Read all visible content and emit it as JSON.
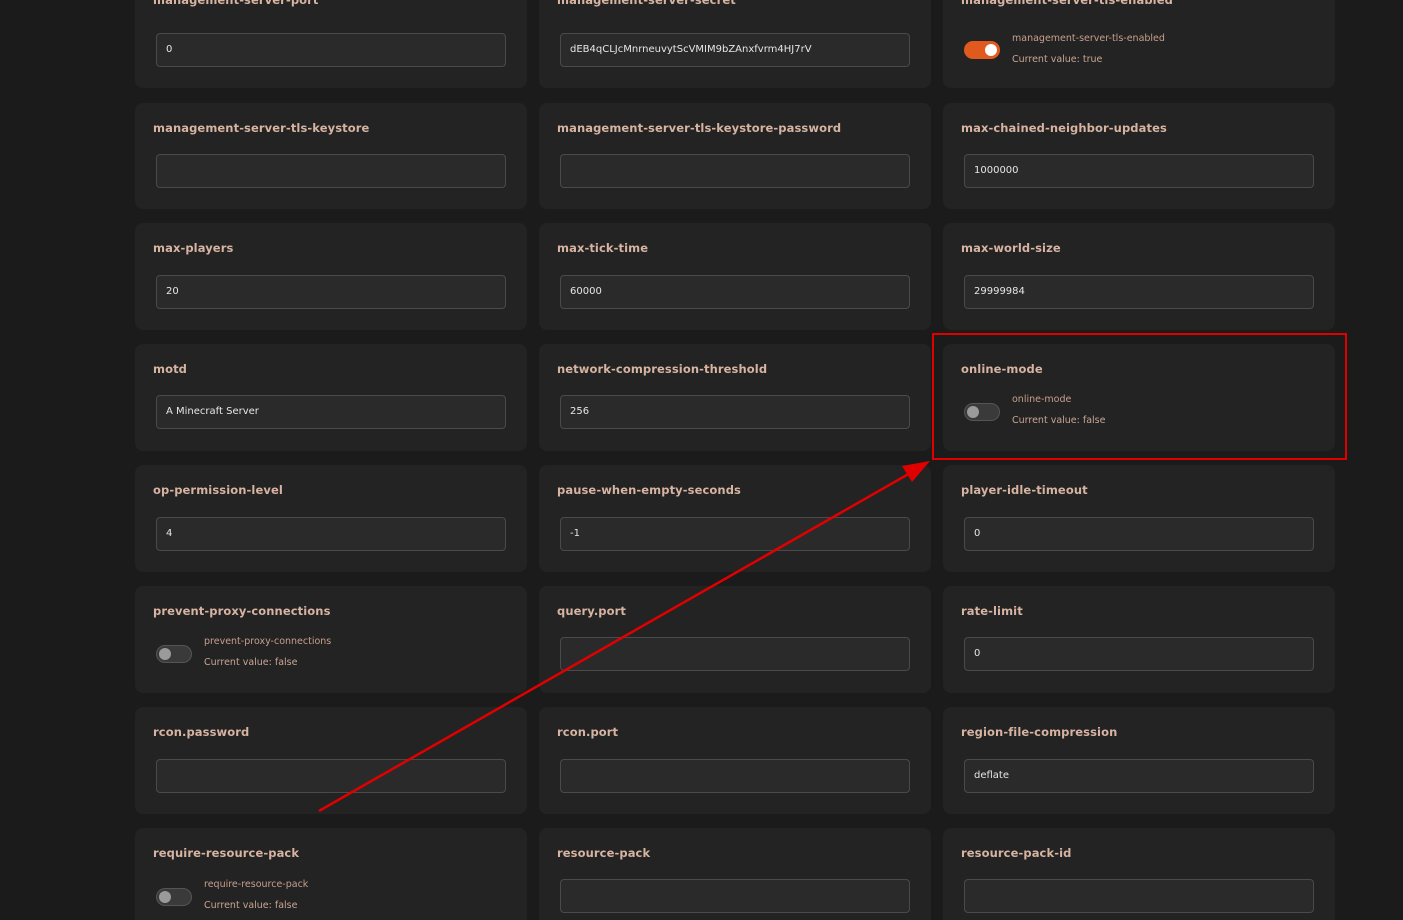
{
  "settings": {
    "management_server_port": {
      "title": "management-server-port",
      "value": "0"
    },
    "management_server_secret": {
      "title": "management-server-secret",
      "value": "dEB4qCLJcMnrneuvytScVMIM9bZAnxfvrm4HJ7rV"
    },
    "management_server_tls_enabled": {
      "title": "management-server-tls-enabled",
      "label": "management-server-tls-enabled",
      "current": "Current value: true",
      "state": "on"
    },
    "management_server_tls_keystore": {
      "title": "management-server-tls-keystore",
      "value": ""
    },
    "management_server_tls_keystore_password": {
      "title": "management-server-tls-keystore-password",
      "value": ""
    },
    "max_chained_neighbor_updates": {
      "title": "max-chained-neighbor-updates",
      "value": "1000000"
    },
    "max_players": {
      "title": "max-players",
      "value": "20"
    },
    "max_tick_time": {
      "title": "max-tick-time",
      "value": "60000"
    },
    "max_world_size": {
      "title": "max-world-size",
      "value": "29999984"
    },
    "motd": {
      "title": "motd",
      "value": "A Minecraft Server"
    },
    "network_compression_threshold": {
      "title": "network-compression-threshold",
      "value": "256"
    },
    "online_mode": {
      "title": "online-mode",
      "label": "online-mode",
      "current": "Current value: false",
      "state": "off"
    },
    "op_permission_level": {
      "title": "op-permission-level",
      "value": "4"
    },
    "pause_when_empty_seconds": {
      "title": "pause-when-empty-seconds",
      "value": "-1"
    },
    "player_idle_timeout": {
      "title": "player-idle-timeout",
      "value": "0"
    },
    "prevent_proxy_connections": {
      "title": "prevent-proxy-connections",
      "label": "prevent-proxy-connections",
      "current": "Current value: false",
      "state": "off"
    },
    "query_port": {
      "title": "query.port",
      "value": ""
    },
    "rate_limit": {
      "title": "rate-limit",
      "value": "0"
    },
    "rcon_password": {
      "title": "rcon.password",
      "value": ""
    },
    "rcon_port": {
      "title": "rcon.port",
      "value": ""
    },
    "region_file_compression": {
      "title": "region-file-compression",
      "value": "deflate"
    },
    "require_resource_pack": {
      "title": "require-resource-pack",
      "label": "require-resource-pack",
      "current": "Current value: false",
      "state": "off"
    },
    "resource_pack": {
      "title": "resource-pack",
      "value": ""
    },
    "resource_pack_id": {
      "title": "resource-pack-id",
      "value": ""
    }
  },
  "colors": {
    "accent": "#e05a1e",
    "annotation": "#e00000",
    "title": "#d7b3a2",
    "background": "#1b1b1b",
    "card": "#232323"
  }
}
